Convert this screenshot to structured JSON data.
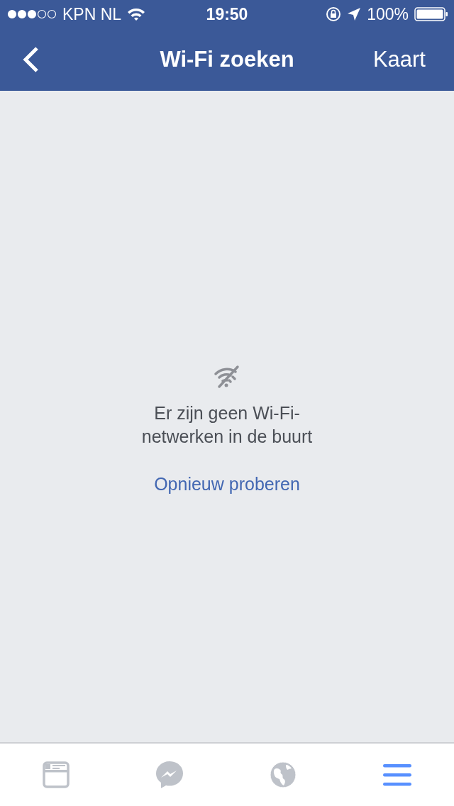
{
  "status_bar": {
    "carrier": "KPN NL",
    "time": "19:50",
    "battery": "100%"
  },
  "nav": {
    "title": "Wi-Fi zoeken",
    "action": "Kaart"
  },
  "empty_state": {
    "message": "Er zijn geen Wi-Fi-netwerken in de buurt",
    "retry": "Opnieuw proberen"
  },
  "tabs": [
    {
      "kind": "feed",
      "selected": false
    },
    {
      "kind": "messenger",
      "selected": false
    },
    {
      "kind": "globe",
      "selected": false
    },
    {
      "kind": "menu",
      "selected": true
    }
  ]
}
